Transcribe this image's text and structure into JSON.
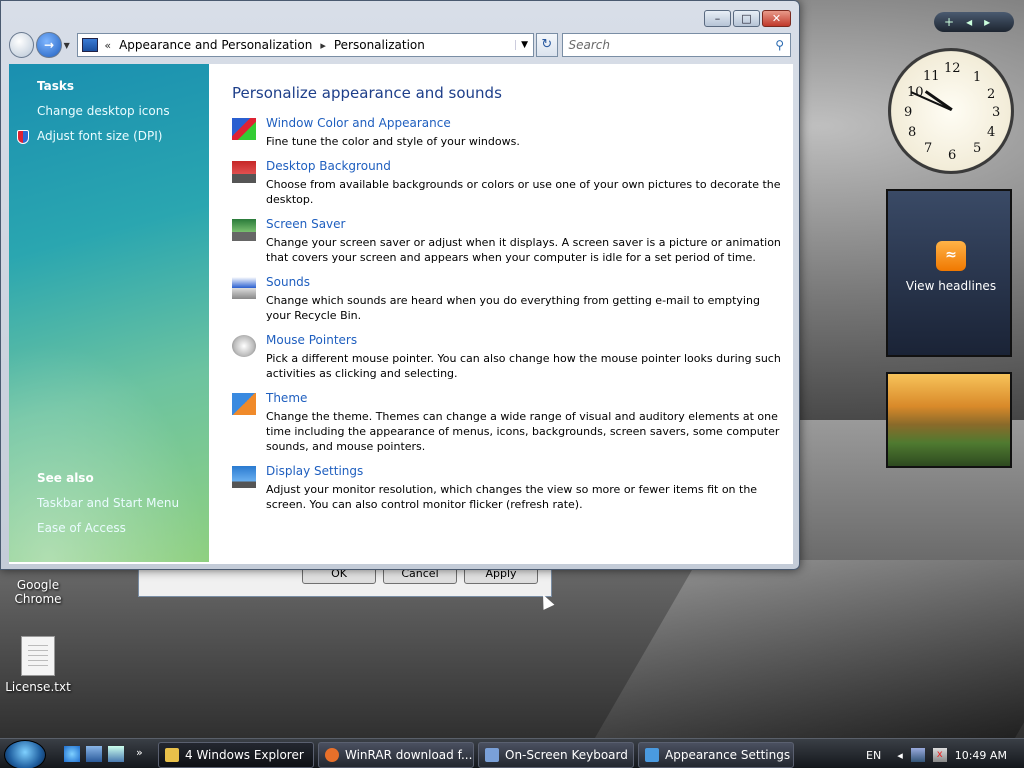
{
  "window": {
    "address": {
      "overflow": "«",
      "parts": [
        "Appearance and Personalization",
        "Personalization"
      ],
      "separator": "▸"
    },
    "search_placeholder": "Search",
    "caption": {
      "minimize": "▭",
      "maximize": "□",
      "close": "✕"
    }
  },
  "sidebar": {
    "tasks_heading": "Tasks",
    "tasks": [
      "Change desktop icons",
      "Adjust font size (DPI)"
    ],
    "see_also_heading": "See also",
    "see_also": [
      "Taskbar and Start Menu",
      "Ease of Access"
    ]
  },
  "content": {
    "title": "Personalize appearance and sounds",
    "items": [
      {
        "label": "Window Color and Appearance",
        "desc": "Fine tune the color and style of your windows.",
        "icon": "window-color-icon"
      },
      {
        "label": "Desktop Background",
        "desc": "Choose from available backgrounds or colors or use one of your own pictures to decorate the desktop.",
        "icon": "desktop-background-icon"
      },
      {
        "label": "Screen Saver",
        "desc": "Change your screen saver or adjust when it displays. A screen saver is a picture or animation that covers your screen and appears when your computer is idle for a set period of time.",
        "icon": "screen-saver-icon"
      },
      {
        "label": "Sounds",
        "desc": "Change which sounds are heard when you do everything from getting e-mail to emptying your Recycle Bin.",
        "icon": "sounds-icon"
      },
      {
        "label": "Mouse Pointers",
        "desc": "Pick a different mouse pointer. You can also change how the mouse pointer looks during such activities as clicking and selecting.",
        "icon": "mouse-pointers-icon"
      },
      {
        "label": "Theme",
        "desc": "Change the theme. Themes can change a wide range of visual and auditory elements at one time including the appearance of menus, icons, backgrounds, screen savers, some computer sounds, and mouse pointers.",
        "icon": "theme-icon"
      },
      {
        "label": "Display Settings",
        "desc": "Adjust your monitor resolution, which changes the view so more or fewer items fit on the screen. You can also control monitor flicker (refresh rate).",
        "icon": "display-settings-icon"
      }
    ]
  },
  "background_dialog": {
    "buttons": [
      "OK",
      "Cancel",
      "Apply"
    ]
  },
  "desktop": {
    "icons": [
      "Google Chrome",
      "License.txt"
    ]
  },
  "gadgets": {
    "sidebar_controls": [
      "+",
      "◂",
      "▸"
    ],
    "clock_numbers": [
      "12",
      "1",
      "2",
      "3",
      "4",
      "5",
      "6",
      "7",
      "8",
      "9",
      "10",
      "11"
    ],
    "feed_label": "View headlines"
  },
  "taskbar": {
    "buttons": [
      {
        "label": "4 Windows Explorer",
        "icon": "folder-icon",
        "color": "#e8c04a"
      },
      {
        "label": "WinRAR download f...",
        "icon": "firefox-icon",
        "color": "#e8702a"
      },
      {
        "label": "On-Screen Keyboard",
        "icon": "keyboard-icon",
        "color": "#7aa0d8"
      },
      {
        "label": "Appearance Settings",
        "icon": "appearance-icon",
        "color": "#4a9ae0"
      }
    ],
    "language": "EN",
    "clock": "10:49 AM"
  }
}
